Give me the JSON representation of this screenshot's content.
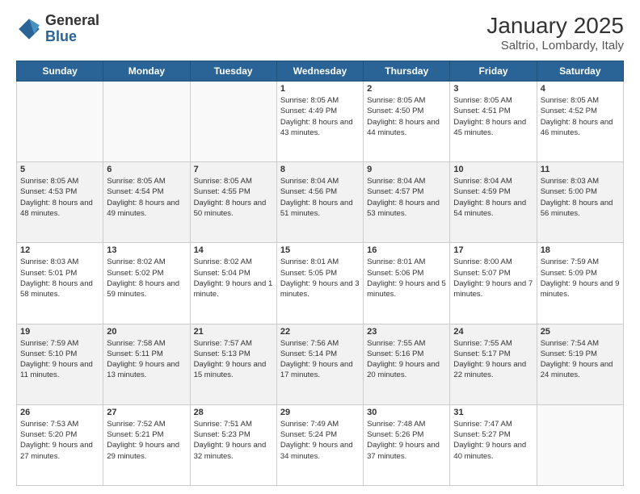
{
  "header": {
    "logo_general": "General",
    "logo_blue": "Blue",
    "title": "January 2025",
    "subtitle": "Saltrio, Lombardy, Italy"
  },
  "weekdays": [
    "Sunday",
    "Monday",
    "Tuesday",
    "Wednesday",
    "Thursday",
    "Friday",
    "Saturday"
  ],
  "weeks": [
    [
      {
        "day": null
      },
      {
        "day": null
      },
      {
        "day": null
      },
      {
        "day": 1,
        "sunrise": "8:05 AM",
        "sunset": "4:49 PM",
        "daylight": "8 hours and 43 minutes."
      },
      {
        "day": 2,
        "sunrise": "8:05 AM",
        "sunset": "4:50 PM",
        "daylight": "8 hours and 44 minutes."
      },
      {
        "day": 3,
        "sunrise": "8:05 AM",
        "sunset": "4:51 PM",
        "daylight": "8 hours and 45 minutes."
      },
      {
        "day": 4,
        "sunrise": "8:05 AM",
        "sunset": "4:52 PM",
        "daylight": "8 hours and 46 minutes."
      }
    ],
    [
      {
        "day": 5,
        "sunrise": "8:05 AM",
        "sunset": "4:53 PM",
        "daylight": "8 hours and 48 minutes."
      },
      {
        "day": 6,
        "sunrise": "8:05 AM",
        "sunset": "4:54 PM",
        "daylight": "8 hours and 49 minutes."
      },
      {
        "day": 7,
        "sunrise": "8:05 AM",
        "sunset": "4:55 PM",
        "daylight": "8 hours and 50 minutes."
      },
      {
        "day": 8,
        "sunrise": "8:04 AM",
        "sunset": "4:56 PM",
        "daylight": "8 hours and 51 minutes."
      },
      {
        "day": 9,
        "sunrise": "8:04 AM",
        "sunset": "4:57 PM",
        "daylight": "8 hours and 53 minutes."
      },
      {
        "day": 10,
        "sunrise": "8:04 AM",
        "sunset": "4:59 PM",
        "daylight": "8 hours and 54 minutes."
      },
      {
        "day": 11,
        "sunrise": "8:03 AM",
        "sunset": "5:00 PM",
        "daylight": "8 hours and 56 minutes."
      }
    ],
    [
      {
        "day": 12,
        "sunrise": "8:03 AM",
        "sunset": "5:01 PM",
        "daylight": "8 hours and 58 minutes."
      },
      {
        "day": 13,
        "sunrise": "8:02 AM",
        "sunset": "5:02 PM",
        "daylight": "8 hours and 59 minutes."
      },
      {
        "day": 14,
        "sunrise": "8:02 AM",
        "sunset": "5:04 PM",
        "daylight": "9 hours and 1 minute."
      },
      {
        "day": 15,
        "sunrise": "8:01 AM",
        "sunset": "5:05 PM",
        "daylight": "9 hours and 3 minutes."
      },
      {
        "day": 16,
        "sunrise": "8:01 AM",
        "sunset": "5:06 PM",
        "daylight": "9 hours and 5 minutes."
      },
      {
        "day": 17,
        "sunrise": "8:00 AM",
        "sunset": "5:07 PM",
        "daylight": "9 hours and 7 minutes."
      },
      {
        "day": 18,
        "sunrise": "7:59 AM",
        "sunset": "5:09 PM",
        "daylight": "9 hours and 9 minutes."
      }
    ],
    [
      {
        "day": 19,
        "sunrise": "7:59 AM",
        "sunset": "5:10 PM",
        "daylight": "9 hours and 11 minutes."
      },
      {
        "day": 20,
        "sunrise": "7:58 AM",
        "sunset": "5:11 PM",
        "daylight": "9 hours and 13 minutes."
      },
      {
        "day": 21,
        "sunrise": "7:57 AM",
        "sunset": "5:13 PM",
        "daylight": "9 hours and 15 minutes."
      },
      {
        "day": 22,
        "sunrise": "7:56 AM",
        "sunset": "5:14 PM",
        "daylight": "9 hours and 17 minutes."
      },
      {
        "day": 23,
        "sunrise": "7:55 AM",
        "sunset": "5:16 PM",
        "daylight": "9 hours and 20 minutes."
      },
      {
        "day": 24,
        "sunrise": "7:55 AM",
        "sunset": "5:17 PM",
        "daylight": "9 hours and 22 minutes."
      },
      {
        "day": 25,
        "sunrise": "7:54 AM",
        "sunset": "5:19 PM",
        "daylight": "9 hours and 24 minutes."
      }
    ],
    [
      {
        "day": 26,
        "sunrise": "7:53 AM",
        "sunset": "5:20 PM",
        "daylight": "9 hours and 27 minutes."
      },
      {
        "day": 27,
        "sunrise": "7:52 AM",
        "sunset": "5:21 PM",
        "daylight": "9 hours and 29 minutes."
      },
      {
        "day": 28,
        "sunrise": "7:51 AM",
        "sunset": "5:23 PM",
        "daylight": "9 hours and 32 minutes."
      },
      {
        "day": 29,
        "sunrise": "7:49 AM",
        "sunset": "5:24 PM",
        "daylight": "9 hours and 34 minutes."
      },
      {
        "day": 30,
        "sunrise": "7:48 AM",
        "sunset": "5:26 PM",
        "daylight": "9 hours and 37 minutes."
      },
      {
        "day": 31,
        "sunrise": "7:47 AM",
        "sunset": "5:27 PM",
        "daylight": "9 hours and 40 minutes."
      },
      {
        "day": null
      }
    ]
  ]
}
